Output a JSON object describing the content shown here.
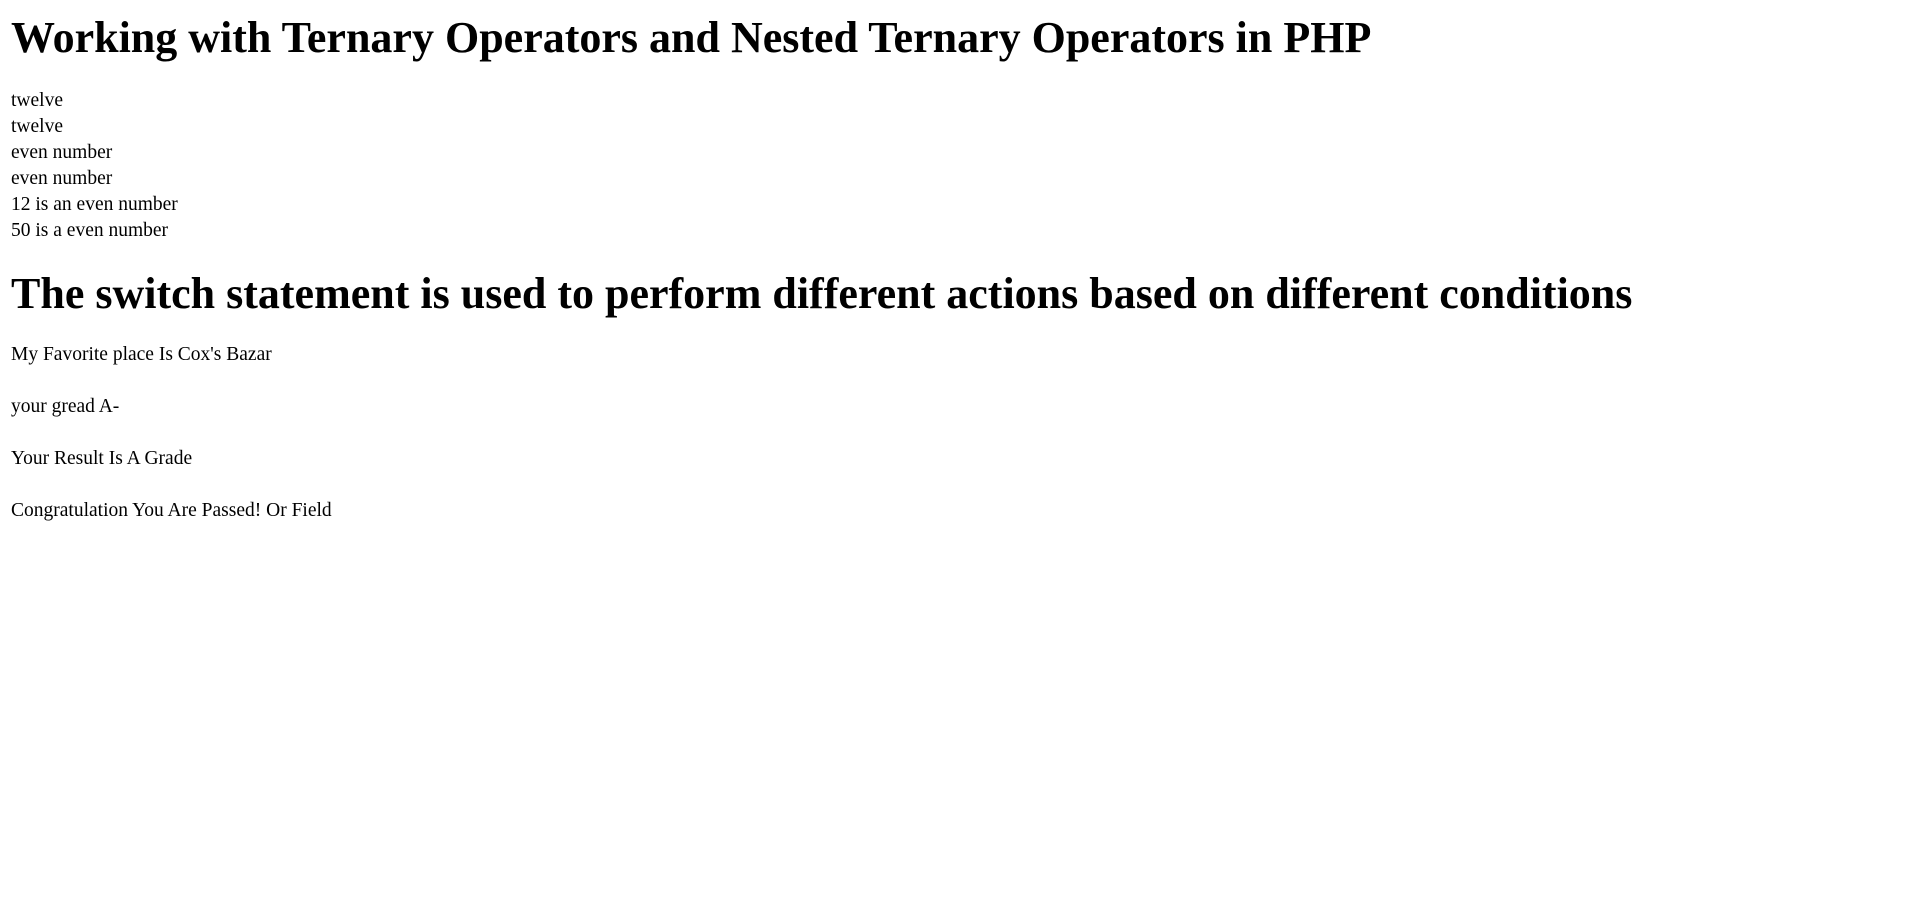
{
  "section_ternary": {
    "heading": "Working with Ternary Operators and Nested Ternary Operators in PHP",
    "output_lines": [
      "twelve",
      "twelve",
      "even number",
      "even number",
      "12 is an even number",
      "50 is a even number"
    ]
  },
  "section_switch": {
    "heading": "The switch statement is used to perform different actions based on different conditions",
    "paragraphs": [
      "My Favorite place Is Cox's Bazar",
      "your gread A-",
      "Your Result Is A Grade",
      "Congratulation You Are Passed! Or Field"
    ]
  }
}
